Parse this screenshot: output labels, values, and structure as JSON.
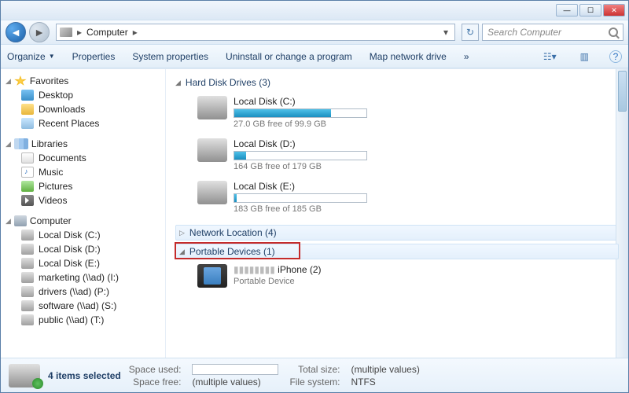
{
  "breadcrumb": {
    "root": "Computer"
  },
  "search": {
    "placeholder": "Search Computer"
  },
  "toolbar": {
    "organize": "Organize",
    "properties": "Properties",
    "system_properties": "System properties",
    "uninstall": "Uninstall or change a program",
    "map_drive": "Map network drive"
  },
  "sidebar": {
    "favorites": {
      "label": "Favorites",
      "items": [
        "Desktop",
        "Downloads",
        "Recent Places"
      ]
    },
    "libraries": {
      "label": "Libraries",
      "items": [
        "Documents",
        "Music",
        "Pictures",
        "Videos"
      ]
    },
    "computer": {
      "label": "Computer",
      "items": [
        "Local Disk (C:)",
        "Local Disk (D:)",
        "Local Disk (E:)",
        "marketing (\\\\ad) (I:)",
        "drivers (\\\\ad) (P:)",
        "software (\\\\ad) (S:)",
        "public (\\\\ad) (T:)"
      ]
    }
  },
  "main": {
    "hdd": {
      "title": "Hard Disk Drives (3)",
      "drives": [
        {
          "name": "Local Disk (C:)",
          "free": "27.0 GB free of 99.9 GB",
          "fill": 73
        },
        {
          "name": "Local Disk (D:)",
          "free": "164 GB free of 179 GB",
          "fill": 9
        },
        {
          "name": "Local Disk (E:)",
          "free": "183 GB free of 185 GB",
          "fill": 2
        }
      ]
    },
    "network": {
      "title": "Network Location (4)"
    },
    "portable": {
      "title": "Portable Devices (1)",
      "device": {
        "name": "iPhone (2)",
        "type": "Portable Device"
      }
    }
  },
  "status": {
    "selected": "4 items selected",
    "space_used_lbl": "Space used:",
    "space_free_lbl": "Space free:",
    "space_free_val": "(multiple values)",
    "total_size_lbl": "Total size:",
    "total_size_val": "(multiple values)",
    "fs_lbl": "File system:",
    "fs_val": "NTFS"
  }
}
